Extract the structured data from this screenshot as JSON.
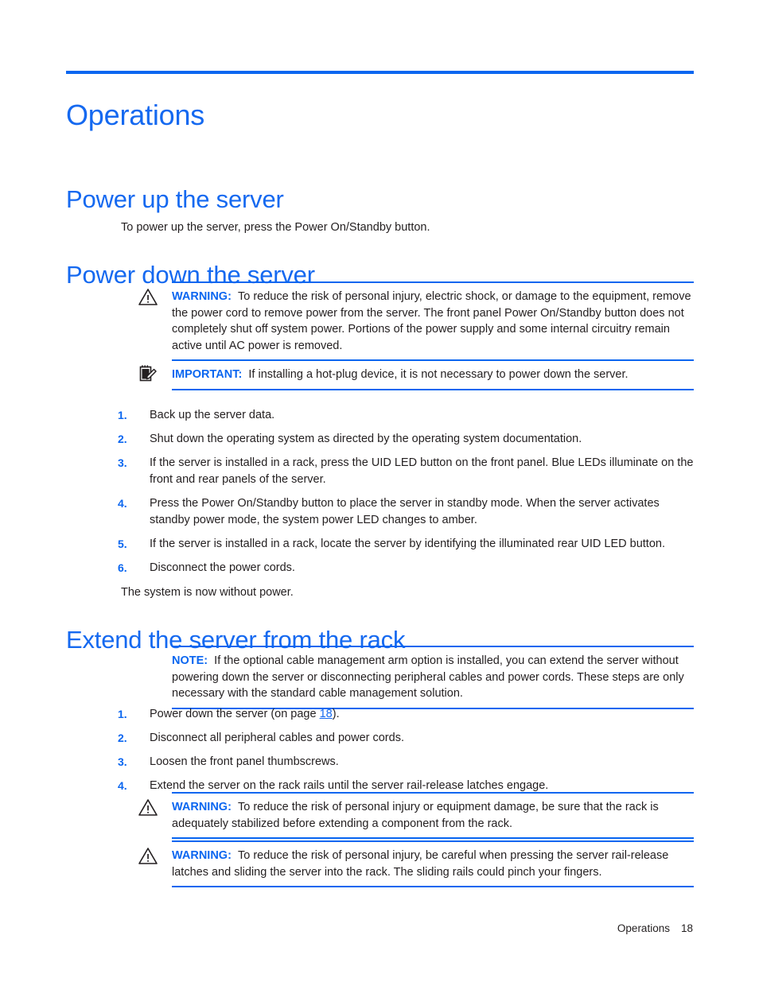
{
  "page": {
    "title": "Operations",
    "accent_blue": "#1569f0",
    "rule_blue": "#0a66f0",
    "body_color": "#231f20"
  },
  "sections": {
    "power_up": {
      "heading": "Power up the server",
      "paragraph": "To power up the server, press the Power On/Standby button."
    },
    "power_down": {
      "heading": "Power down the server",
      "warning": {
        "label": "WARNING:",
        "icon": "warning-triangle-icon",
        "text": "To reduce the risk of personal injury, electric shock, or damage to the equipment, remove the power cord to remove power from the server. The front panel Power On/Standby button does not completely shut off system power. Portions of the power supply and some internal circuitry remain active until AC power is removed."
      },
      "important": {
        "label": "IMPORTANT:",
        "icon": "notepad-pencil-icon",
        "text": "If installing a hot-plug device, it is not necessary to power down the server."
      },
      "steps": [
        {
          "num": "1.",
          "text": "Back up the server data."
        },
        {
          "num": "2.",
          "text": "Shut down the operating system as directed by the operating system documentation."
        },
        {
          "num": "3.",
          "text": "If the server is installed in a rack, press the UID LED button on the front panel. Blue LEDs illuminate on the front and rear panels of the server."
        },
        {
          "num": "4.",
          "text": "Press the Power On/Standby button to place the server in standby mode. When the server activates standby power mode, the system power LED changes to amber."
        },
        {
          "num": "5.",
          "text": "If the server is installed in a rack, locate the server by identifying the illuminated rear UID LED button."
        },
        {
          "num": "6.",
          "text": "Disconnect the power cords."
        }
      ],
      "closing": "The system is now without power."
    },
    "extend": {
      "heading": "Extend the server from the rack",
      "note": {
        "label": "NOTE:",
        "text": "If the optional cable management arm option is installed, you can extend the server without powering down the server or disconnecting peripheral cables and power cords. These steps are only necessary with the standard cable management solution."
      },
      "steps": [
        {
          "num": "1.",
          "text_before": "Power down the server (on page ",
          "link": "18",
          "text_after": ")."
        },
        {
          "num": "2.",
          "text": "Disconnect all peripheral cables and power cords."
        },
        {
          "num": "3.",
          "text": "Loosen the front panel thumbscrews."
        },
        {
          "num": "4.",
          "text": "Extend the server on the rack rails until the server rail-release latches engage."
        }
      ],
      "warning_rack": {
        "label": "WARNING:",
        "icon": "warning-triangle-icon",
        "text": "To reduce the risk of personal injury or equipment damage, be sure that the rack is adequately stabilized before extending a component from the rack."
      },
      "warning_latches": {
        "label": "WARNING:",
        "icon": "warning-triangle-icon",
        "text": "To reduce the risk of personal injury, be careful when pressing the server rail-release latches and sliding the server into the rack. The sliding rails could pinch your fingers."
      }
    }
  },
  "footer": {
    "section_name": "Operations",
    "page_number": "18"
  }
}
